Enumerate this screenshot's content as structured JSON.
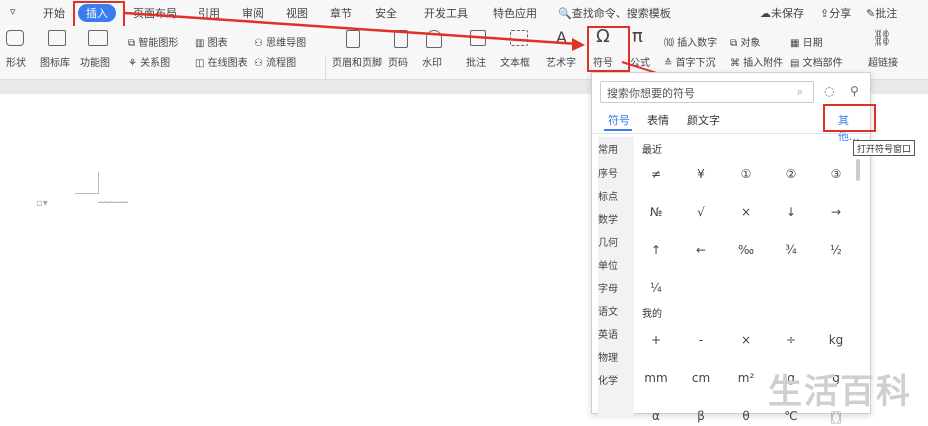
{
  "tabs": [
    "开始",
    "插入",
    "页面布局",
    "引用",
    "审阅",
    "视图",
    "章节",
    "安全",
    "开发工具",
    "特色应用"
  ],
  "search_cmd": "查找命令、搜索模板",
  "right": {
    "unsaved": "未保存",
    "share": "分享",
    "comment": "批注"
  },
  "ribbon": {
    "shape": "形状",
    "icon_lib": "图标库",
    "func_chart": "功能图",
    "smart": "智能图形",
    "chart": "图表",
    "mind": "思维导图",
    "relation": "关系图",
    "online_chart": "在线图表",
    "flow": "流程图",
    "header_footer": "页眉和页脚",
    "page_num": "页码",
    "watermark": "水印",
    "comment": "批注",
    "textbox": "文本框",
    "art": "艺术字",
    "symbol": "符号",
    "formula": "公式",
    "insert_num": "插入数字",
    "object": "对象",
    "date": "日期",
    "dropcap": "首字下沉",
    "attach": "插入附件",
    "docpart": "文档部件",
    "hyperlink": "超链接"
  },
  "panel": {
    "search_placeholder": "搜索你想要的符号",
    "tabs": [
      "符号",
      "表情",
      "颜文字"
    ],
    "more": "其他...",
    "tooltip": "打开符号窗口",
    "categories": [
      "常用",
      "序号",
      "标点",
      "数学",
      "几何",
      "单位",
      "字母",
      "语文",
      "英语",
      "物理",
      "化学"
    ],
    "recent_label": "最近",
    "mine_label": "我的",
    "recent": [
      "≠",
      "¥",
      "①",
      "②",
      "③",
      "№",
      "√",
      "×",
      "↓",
      "→",
      "↑",
      "←",
      "‰",
      "¾",
      "½",
      "¼"
    ],
    "mine": [
      "+",
      "-",
      "×",
      "÷",
      "kg",
      "mm",
      "cm",
      "m²",
      "g",
      "g",
      "α",
      "β",
      "θ",
      "℃",
      "〖〗"
    ]
  },
  "watermark": "生活百科"
}
